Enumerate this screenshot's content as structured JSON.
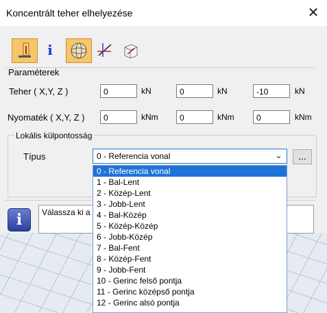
{
  "window": {
    "title": "Koncentrált teher elhelyezése",
    "close_glyph": "✕"
  },
  "toolbar": {
    "items": [
      {
        "icon": "load-placement-icon"
      },
      {
        "icon": "info-icon",
        "glyph": "i"
      },
      {
        "icon": "sphere-icon"
      },
      {
        "icon": "axes-icon"
      },
      {
        "icon": "coordinate-cube-icon"
      }
    ]
  },
  "parameters": {
    "section_label": "Paraméterek",
    "force": {
      "label": "Teher ( X,Y, Z )",
      "x": "0",
      "y": "0",
      "z": "-10",
      "unit": "kN"
    },
    "moment": {
      "label": "Nyomaték ( X,Y, Z )",
      "x": "0",
      "y": "0",
      "z": "0",
      "unit": "kNm"
    }
  },
  "eccentricity": {
    "group_label": "Lokális külpontosság",
    "type_label": "Típus",
    "selected": "0 - Referencia vonal",
    "more_button": "...",
    "options": [
      "0 - Referencia vonal",
      "1 - Bal-Lent",
      "2 - Közép-Lent",
      "3 - Jobb-Lent",
      "4 - Bal-Közép",
      "5 - Közép-Közép",
      "6 - Jobb-Közép",
      "7 - Bal-Fent",
      "8 - Közép-Fent",
      "9 - Jobb-Fent",
      "10 - Gerinc felső pontja",
      "11 - Gerinc középső pontja",
      "12 - Gerinc alsó pontja"
    ]
  },
  "status": {
    "message": "Válassza ki a"
  },
  "colors": {
    "accent": "#1e73d8",
    "active_tool": "#f7c56a"
  }
}
